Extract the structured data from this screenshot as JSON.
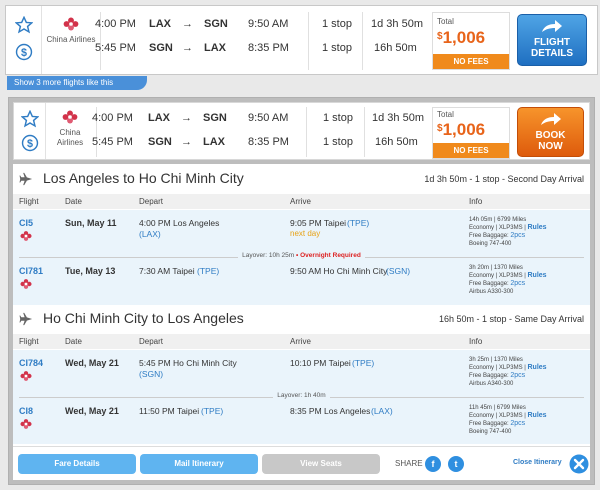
{
  "airline_name": "China Airlines",
  "arrow": "→",
  "colors": {
    "accent_blue": "#2f7cc4",
    "book_orange": "#e8641a",
    "badge_orange": "#f08a1c"
  },
  "icons": [
    "star-icon",
    "dollar-icon",
    "china-airlines-logo-icon",
    "right-arrow-icon",
    "plane-icon",
    "facebook-icon",
    "twitter-icon",
    "close-icon"
  ],
  "result1": {
    "outbound": {
      "depart": "4:00 PM",
      "from": "LAX",
      "to": "SGN",
      "arrive": "9:50 AM",
      "stops": "1 stop",
      "duration": "1d 3h 50m"
    },
    "return": {
      "depart": "5:45 PM",
      "from": "SGN",
      "to": "LAX",
      "arrive": "8:35 PM",
      "stops": "1 stop",
      "duration": "16h 50m"
    },
    "total_label": "Total",
    "currency": "$",
    "price": "1,006",
    "no_fees": "NO FEES",
    "button_line1": "FLIGHT",
    "button_line2": "DETAILS",
    "more_link": "Show 3 more flights like this"
  },
  "result2": {
    "outbound": {
      "depart": "4:00 PM",
      "from": "LAX",
      "to": "SGN",
      "arrive": "9:50 AM",
      "stops": "1 stop",
      "duration": "1d 3h 50m"
    },
    "return": {
      "depart": "5:45 PM",
      "from": "SGN",
      "to": "LAX",
      "arrive": "8:35 PM",
      "stops": "1 stop",
      "duration": "16h 50m"
    },
    "total_label": "Total",
    "currency": "$",
    "price": "1,006",
    "no_fees": "NO FEES",
    "button_line1": "BOOK",
    "button_line2": "NOW"
  },
  "itinerary": {
    "columns": {
      "flight": "Flight",
      "date": "Date",
      "depart": "Depart",
      "arrive": "Arrive",
      "info": "Info"
    },
    "outbound": {
      "title": "Los Angeles to Ho Chi Minh City",
      "summary": "1d 3h 50m - 1 stop - Second Day Arrival",
      "seg1": {
        "code": "CI5",
        "date": "Sun, May 11",
        "dep_time": "4:00 PM Los Angeles",
        "dep_code": "(LAX)",
        "arr_time": "9:05 PM Taipei",
        "arr_code": "(TPE)",
        "note": "next day",
        "info1": "14h 05m | 6799 Miles",
        "info2": "Economy | XLP3MS |",
        "rules": "Rules",
        "info3": "Free Baggage:",
        "bags": "2pcs",
        "info4": "Boeing 747-400"
      },
      "layover_label": "Layover: 10h 25m",
      "layover_bullet": "•",
      "layover_note": "Overnight Required",
      "seg2": {
        "code": "CI781",
        "date": "Tue, May 13",
        "dep_time": "7:30 AM Taipei",
        "dep_code": "(TPE)",
        "arr_time": "9:50 AM Ho Chi Minh City",
        "arr_code": "(SGN)",
        "info1": "3h 20m | 1370 Miles",
        "info2": "Economy | XLP3MS |",
        "rules": "Rules",
        "info3": "Free Baggage:",
        "bags": "2pcs",
        "info4": "Airbus A330-300"
      }
    },
    "return": {
      "title": "Ho Chi Minh City to Los Angeles",
      "summary": "16h 50m - 1 stop - Same Day Arrival",
      "seg1": {
        "code": "CI784",
        "date": "Wed, May 21",
        "dep_time": "5:45 PM Ho Chi Minh City",
        "dep_code": "(SGN)",
        "arr_time": "10:10 PM Taipei",
        "arr_code": "(TPE)",
        "info1": "3h 25m | 1370 Miles",
        "info2": "Economy | XLP3MS |",
        "rules": "Rules",
        "info3": "Free Baggage:",
        "bags": "2pcs",
        "info4": "Airbus A340-300"
      },
      "layover_label": "Layover: 1h 40m",
      "seg2": {
        "code": "CI8",
        "date": "Wed, May 21",
        "dep_time": "11:50 PM Taipei",
        "dep_code": "(TPE)",
        "arr_time": "8:35 PM Los Angeles",
        "arr_code": "(LAX)",
        "info1": "11h 45m | 6799 Miles",
        "info2": "Economy | XLP3MS |",
        "rules": "Rules",
        "info3": "Free Baggage:",
        "bags": "2pcs",
        "info4": "Boeing 747-400"
      }
    }
  },
  "footer": {
    "fare_details": "Fare Details",
    "mail_itinerary": "Mail Itinerary",
    "view_seats": "View Seats",
    "share": "SHARE",
    "facebook_glyph": "f",
    "twitter_glyph": "t",
    "close_itinerary": "Close Itinerary"
  }
}
